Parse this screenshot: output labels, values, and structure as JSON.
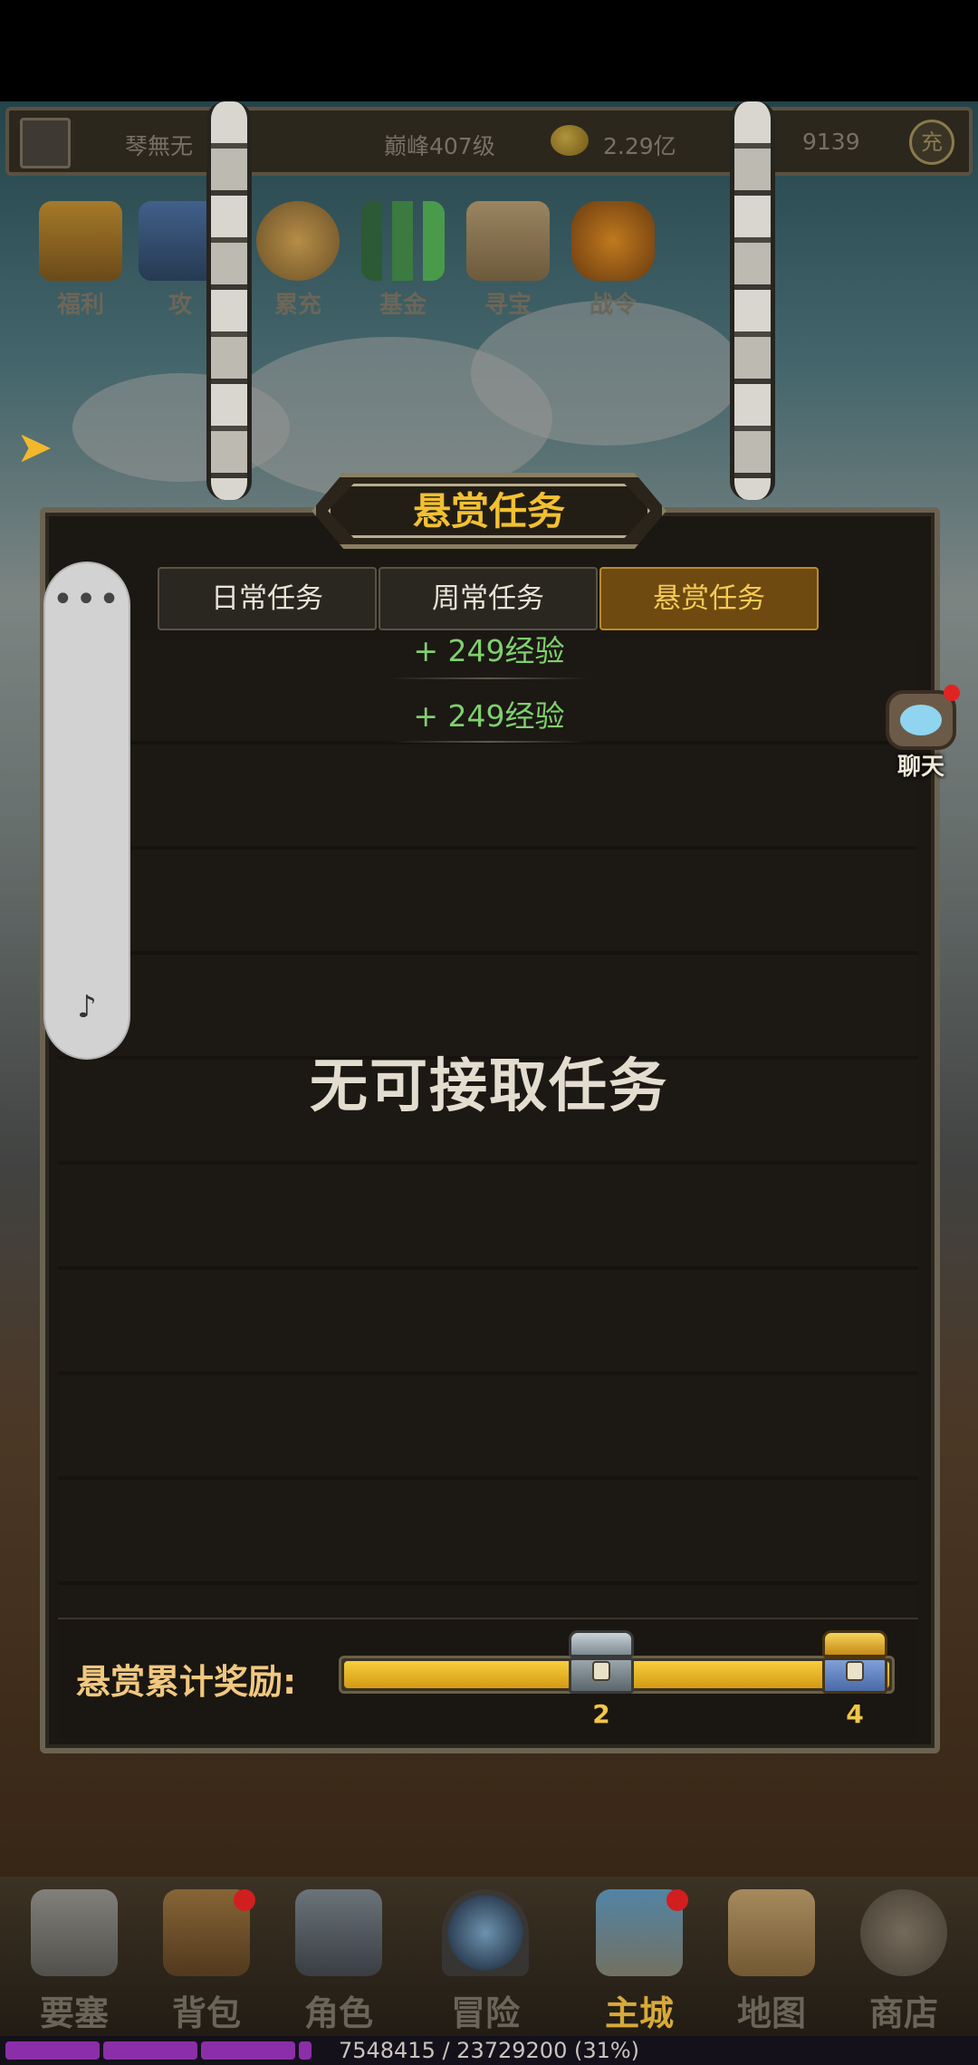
{
  "topbar": {
    "player_name": "琴無无",
    "peak_level": "巅峰407级",
    "gold": "2.29亿",
    "diamonds": "9139",
    "recharge_label": "充"
  },
  "activities": [
    {
      "label": "福利",
      "icon": "chest-icon"
    },
    {
      "label": "攻",
      "icon": "guide-book-icon"
    },
    {
      "label": "累充",
      "icon": "money-bag-icon"
    },
    {
      "label": "基金",
      "icon": "bar-chart-icon"
    },
    {
      "label": "寻宝",
      "icon": "treasure-map-icon"
    },
    {
      "label": "战令",
      "icon": "battle-pass-icon"
    }
  ],
  "panel": {
    "title": "悬赏任务",
    "tabs": [
      {
        "label": "日常任务",
        "active": false
      },
      {
        "label": "周常任务",
        "active": false
      },
      {
        "label": "悬赏任务",
        "active": true
      }
    ],
    "exp_rewards": [
      "+ 249经验",
      "+ 249经验"
    ],
    "empty_message": "无可接取任务",
    "reward_label": "悬赏累计奖励:",
    "progress": 1.0,
    "chests": [
      {
        "count": "2",
        "color": "silver"
      },
      {
        "count": "4",
        "color": "gold"
      }
    ]
  },
  "chat": {
    "label": "聊天"
  },
  "bottom_nav": [
    {
      "label": "要塞",
      "icon": "fortress-icon",
      "badge": false,
      "active": false
    },
    {
      "label": "背包",
      "icon": "backpack-icon",
      "badge": true,
      "active": false
    },
    {
      "label": "角色",
      "icon": "helmet-icon",
      "badge": false,
      "active": false
    },
    {
      "label": "冒险",
      "icon": "portal-icon",
      "badge": false,
      "active": false
    },
    {
      "label": "主城",
      "icon": "castle-icon",
      "badge": true,
      "active": true
    },
    {
      "label": "地图",
      "icon": "scroll-map-icon",
      "badge": false,
      "active": false
    },
    {
      "label": "商店",
      "icon": "shop-icon",
      "badge": false,
      "active": false
    }
  ],
  "experience": {
    "text": "7548415 / 23729200 (31%)",
    "fraction": 0.31
  },
  "colors": {
    "accent_gold": "#f2c033",
    "exp_green": "#7fd06d",
    "active_tab": "#6e4a10",
    "exp_purple": "#8b2fa8"
  }
}
